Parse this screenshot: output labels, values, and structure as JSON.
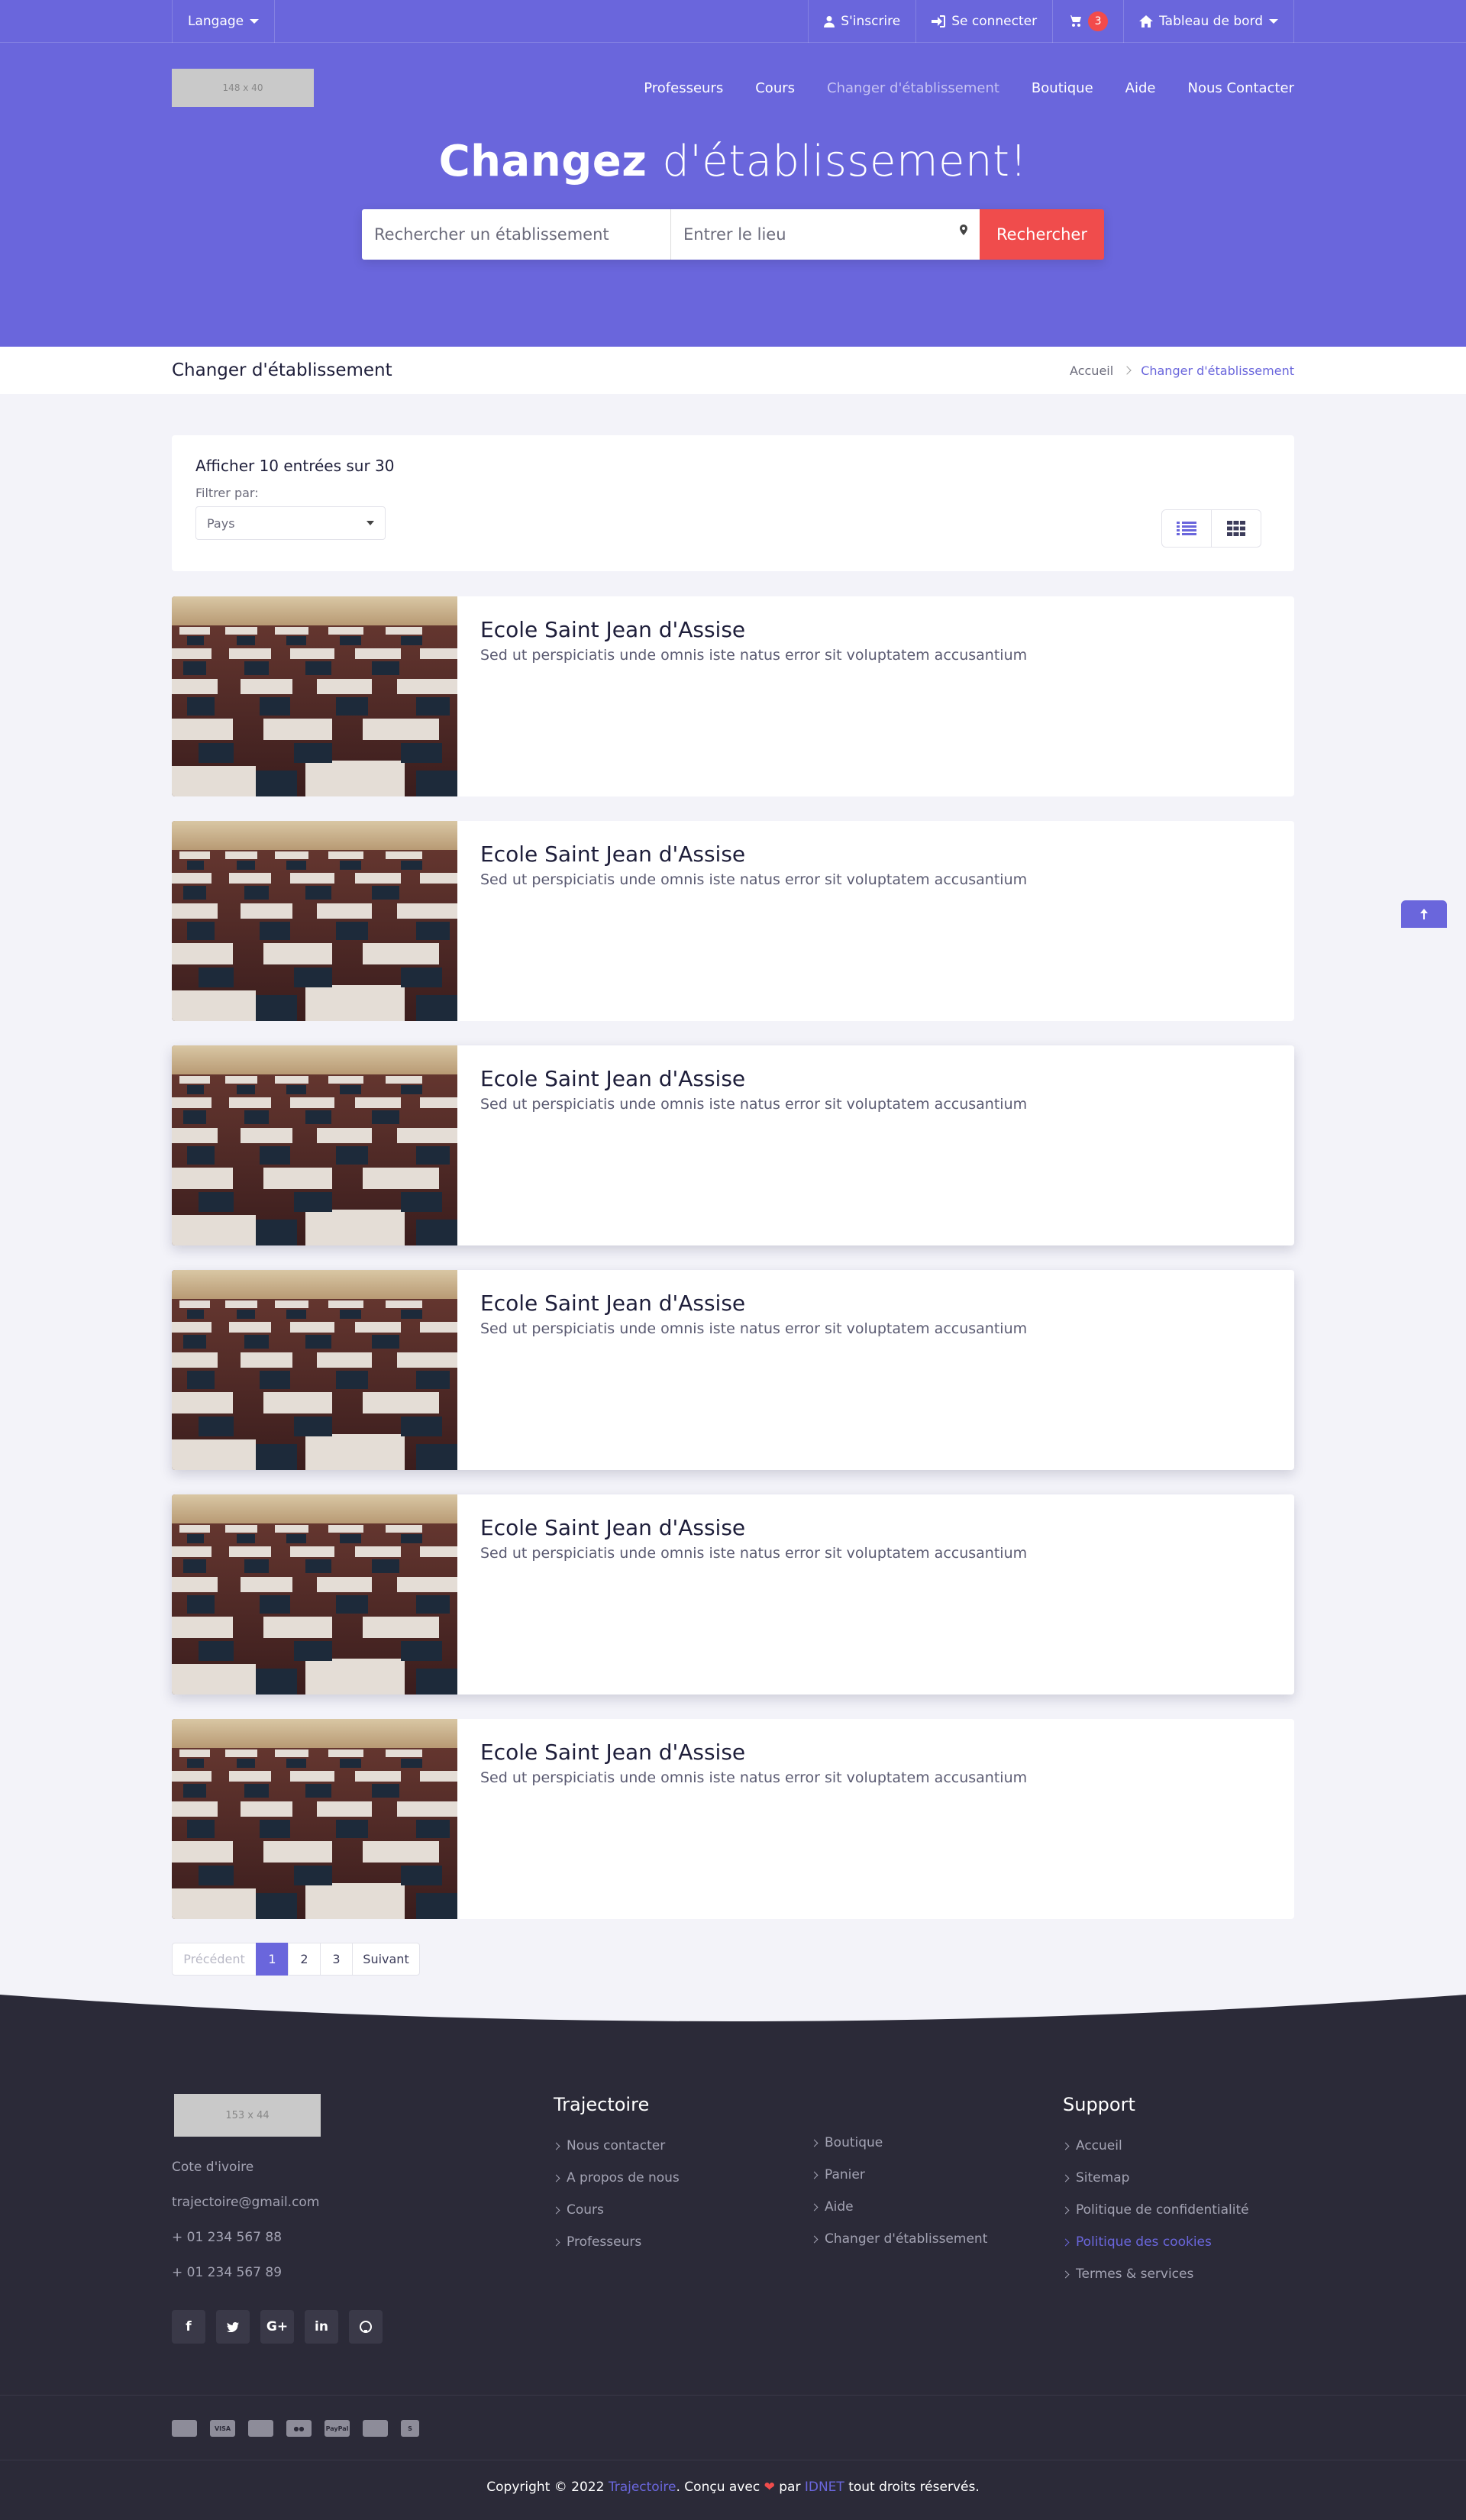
{
  "topbar": {
    "language": "Langage",
    "signup": "S'inscrire",
    "login": "Se connecter",
    "cart_count": "3",
    "dashboard": "Tableau de bord"
  },
  "navbar": {
    "logo_placeholder": "148 x 40",
    "links": [
      "Professeurs",
      "Cours",
      "Changer d'établissement",
      "Boutique",
      "Aide",
      "Nous Contacter"
    ],
    "active_index": 2
  },
  "hero": {
    "title_bold": "Changez",
    "title_rest": "d'établissement!",
    "search_placeholder": "Rechercher un établissement",
    "location_placeholder": "Entrer le lieu",
    "search_button": "Rechercher"
  },
  "page": {
    "title": "Changer d'établissement",
    "breadcrumb": [
      "Accueil",
      "Changer d'établissement"
    ]
  },
  "filter": {
    "count_text": "Afficher 10 entrées sur 30",
    "filter_label": "Filtrer par:",
    "select_value": "Pays"
  },
  "schools": [
    {
      "name": "Ecole Saint Jean d'Assise",
      "description": "Sed ut perspiciatis unde omnis iste natus error sit voluptatem accusantium"
    },
    {
      "name": "Ecole Saint Jean d'Assise",
      "description": "Sed ut perspiciatis unde omnis iste natus error sit voluptatem accusantium"
    },
    {
      "name": "Ecole Saint Jean d'Assise",
      "description": "Sed ut perspiciatis unde omnis iste natus error sit voluptatem accusantium"
    },
    {
      "name": "Ecole Saint Jean d'Assise",
      "description": "Sed ut perspiciatis unde omnis iste natus error sit voluptatem accusantium"
    },
    {
      "name": "Ecole Saint Jean d'Assise",
      "description": "Sed ut perspiciatis unde omnis iste natus error sit voluptatem accusantium"
    },
    {
      "name": "Ecole Saint Jean d'Assise",
      "description": "Sed ut perspiciatis unde omnis iste natus error sit voluptatem accusantium"
    }
  ],
  "pagination": {
    "prev": "Précédent",
    "pages": [
      "1",
      "2",
      "3"
    ],
    "next": "Suivant"
  },
  "footer": {
    "logo_placeholder": "153 x 44",
    "contact": [
      "Cote d'ivoire",
      "trajectoire@gmail.com",
      "+ 01 234 567 88",
      "+ 01 234 567 89"
    ],
    "socials": [
      "facebook-icon",
      "twitter-icon",
      "google-plus-icon",
      "linkedin-icon",
      "github-icon"
    ],
    "col1_title": "Trajectoire",
    "col1_links": [
      "Nous contacter",
      "A propos de nous",
      "Cours",
      "Professeurs"
    ],
    "col2_links": [
      "Boutique",
      "Panier",
      "Aide",
      "Changer d'établissement"
    ],
    "col3_title": "Support",
    "col3_links": [
      "Accueil",
      "Sitemap",
      "Politique de confidentialité",
      "Politique des cookies",
      "Termes & services"
    ],
    "payment_icons": [
      "card-icon",
      "visa-icon",
      "credit-card-icon",
      "mastercard-icon",
      "paypal-icon",
      "discover-icon",
      "stripe-icon"
    ],
    "copyright_prefix": "Copyright © 2022",
    "copyright_brand": "Trajectoire",
    "copyright_mid": ". Conçu avec",
    "copyright_by": "par",
    "copyright_company": "IDNET",
    "copyright_suffix": "tout droits réservés."
  },
  "colors": {
    "primary": "#6a66dc",
    "accent_red": "#f04c4c",
    "footer_bg": "#2b2a38",
    "page_bg": "#f3f3f9"
  }
}
